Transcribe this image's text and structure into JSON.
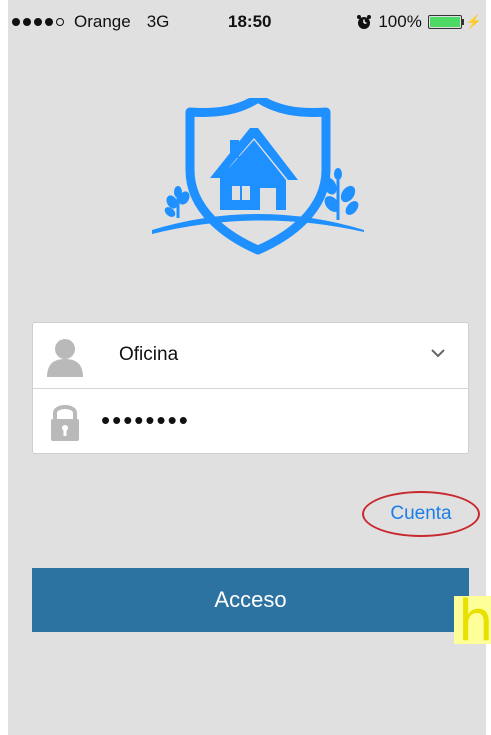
{
  "status_bar": {
    "carrier": "Orange",
    "network": "3G",
    "time": "18:50",
    "battery_percent": "100%",
    "battery_level": 1.0,
    "signal_bars_filled": 4,
    "signal_bars_total": 5
  },
  "logo": {
    "icon": "house-shield-icon",
    "color": "#1e90ff"
  },
  "form": {
    "user_value": "Oficina",
    "password_masked": "••••••••"
  },
  "account_link": {
    "label": "Cuenta",
    "highlight_color": "#c8282e"
  },
  "access_button": {
    "label": "Acceso",
    "color": "#2d73a2"
  },
  "overlay": {
    "glyph": "h"
  }
}
